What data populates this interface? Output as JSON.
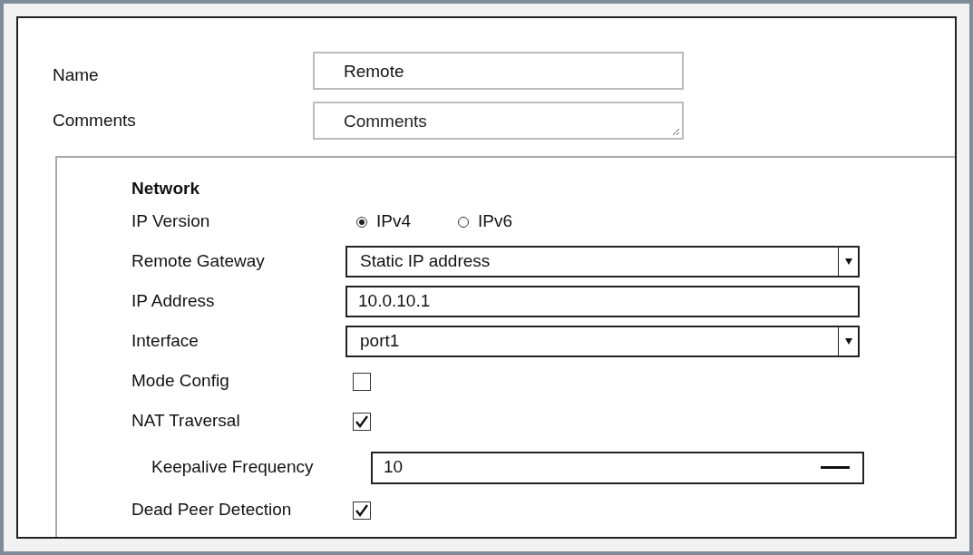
{
  "name": {
    "label": "Name",
    "value": "Remote"
  },
  "comments": {
    "label": "Comments",
    "placeholder": "Comments"
  },
  "network": {
    "title": "Network",
    "rows": [
      {
        "kind": "radio",
        "label": "IP Version",
        "options": [
          {
            "label": "IPv4",
            "selected": true
          },
          {
            "label": "IPv6",
            "selected": false
          }
        ]
      },
      {
        "kind": "select",
        "label": "Remote Gateway",
        "value": "Static IP address"
      },
      {
        "kind": "text",
        "label": "IP Address",
        "value": "10.0.10.1"
      },
      {
        "kind": "select",
        "label": "Interface",
        "value": "port1"
      },
      {
        "kind": "checkbox",
        "label": "Mode Config",
        "checked": false
      },
      {
        "kind": "checkbox",
        "label": "NAT Traversal",
        "checked": true
      },
      {
        "kind": "number",
        "label": "Keepalive Frequency",
        "value": "10"
      },
      {
        "kind": "checkbox",
        "label": "Dead Peer Detection",
        "checked": true
      }
    ]
  }
}
